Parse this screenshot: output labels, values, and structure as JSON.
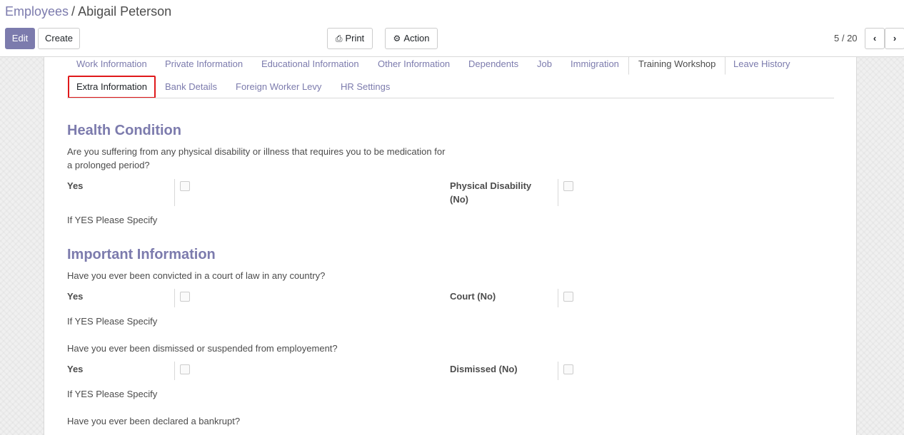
{
  "breadcrumb": {
    "parent": "Employees",
    "separator": "/",
    "current": "Abigail Peterson"
  },
  "toolbar": {
    "edit_label": "Edit",
    "create_label": "Create",
    "print_label": "Print",
    "action_label": "Action"
  },
  "pager": {
    "value": "5 / 20",
    "prev": "‹",
    "next": "›"
  },
  "tabs": [
    {
      "label": "Work Information"
    },
    {
      "label": "Private Information"
    },
    {
      "label": "Educational Information"
    },
    {
      "label": "Other Information"
    },
    {
      "label": "Dependents"
    },
    {
      "label": "Job"
    },
    {
      "label": "Immigration"
    },
    {
      "label": "Training Workshop"
    },
    {
      "label": "Leave History"
    },
    {
      "label": "Extra Information"
    },
    {
      "label": "Bank Details"
    },
    {
      "label": "Foreign Worker Levy"
    },
    {
      "label": "HR Settings"
    }
  ],
  "health": {
    "title": "Health Condition",
    "question": "Are you suffering from any physical disability or illness that requires you to be medication for a prolonged period?",
    "yes_label": "Yes",
    "no_label": "Physical Disability (No)",
    "specify_label": "If YES Please Specify"
  },
  "important": {
    "title": "Important Information",
    "court_question": "Have you ever been convicted in a court of law in any country?",
    "court_yes_label": "Yes",
    "court_no_label": "Court (No)",
    "court_specify_label": "If YES Please Specify",
    "dismiss_question": "Have you ever been dismissed or suspended from employement?",
    "dismiss_yes_label": "Yes",
    "dismiss_no_label": "Dismissed (No)",
    "dismiss_specify_label": "If YES Please Specify",
    "bankrupt_question": "Have you ever been declared a bankrupt?"
  },
  "colors": {
    "accent": "#7c7bad",
    "highlight": "#e0191b"
  }
}
